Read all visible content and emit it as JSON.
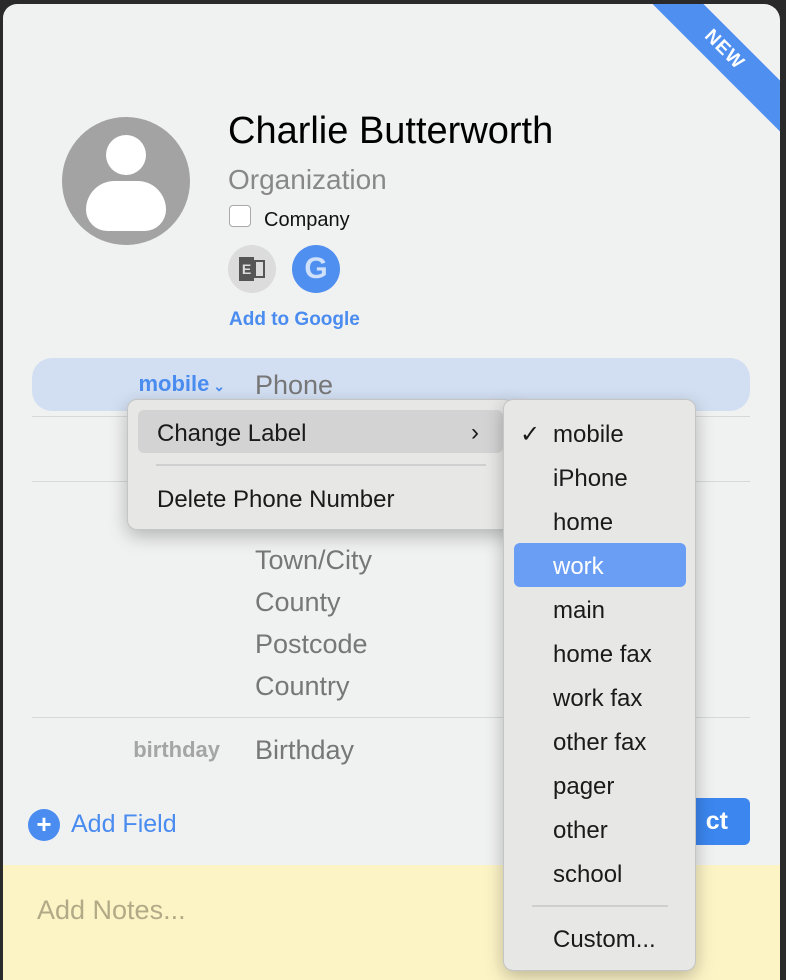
{
  "badge": "NEW",
  "contact": {
    "name": "Charlie Butterworth",
    "organization_placeholder": "Organization",
    "company_label": "Company",
    "company_checked": false,
    "add_to_google": "Add to Google"
  },
  "accounts": [
    {
      "icon": "exchange-icon"
    },
    {
      "icon": "google-icon"
    }
  ],
  "phone": {
    "label": "mobile",
    "placeholder": "Phone"
  },
  "address": [
    "Town/City",
    "County",
    "Postcode",
    "Country"
  ],
  "birthday": {
    "label": "birthday",
    "placeholder": "Birthday"
  },
  "add_field": "Add Field",
  "primary_button_visible": "ct",
  "notes_placeholder": "Add Notes...",
  "context_menu": {
    "change_label": "Change Label",
    "delete": "Delete Phone Number"
  },
  "label_menu": {
    "items": [
      "mobile",
      "iPhone",
      "home",
      "work",
      "main",
      "home fax",
      "work fax",
      "other fax",
      "pager",
      "other",
      "school"
    ],
    "selected": "mobile",
    "highlighted": "work",
    "custom": "Custom..."
  },
  "colors": {
    "accent": "#4a8cf0",
    "highlight": "#6a9ef5",
    "notes": "#fdf4c6"
  }
}
